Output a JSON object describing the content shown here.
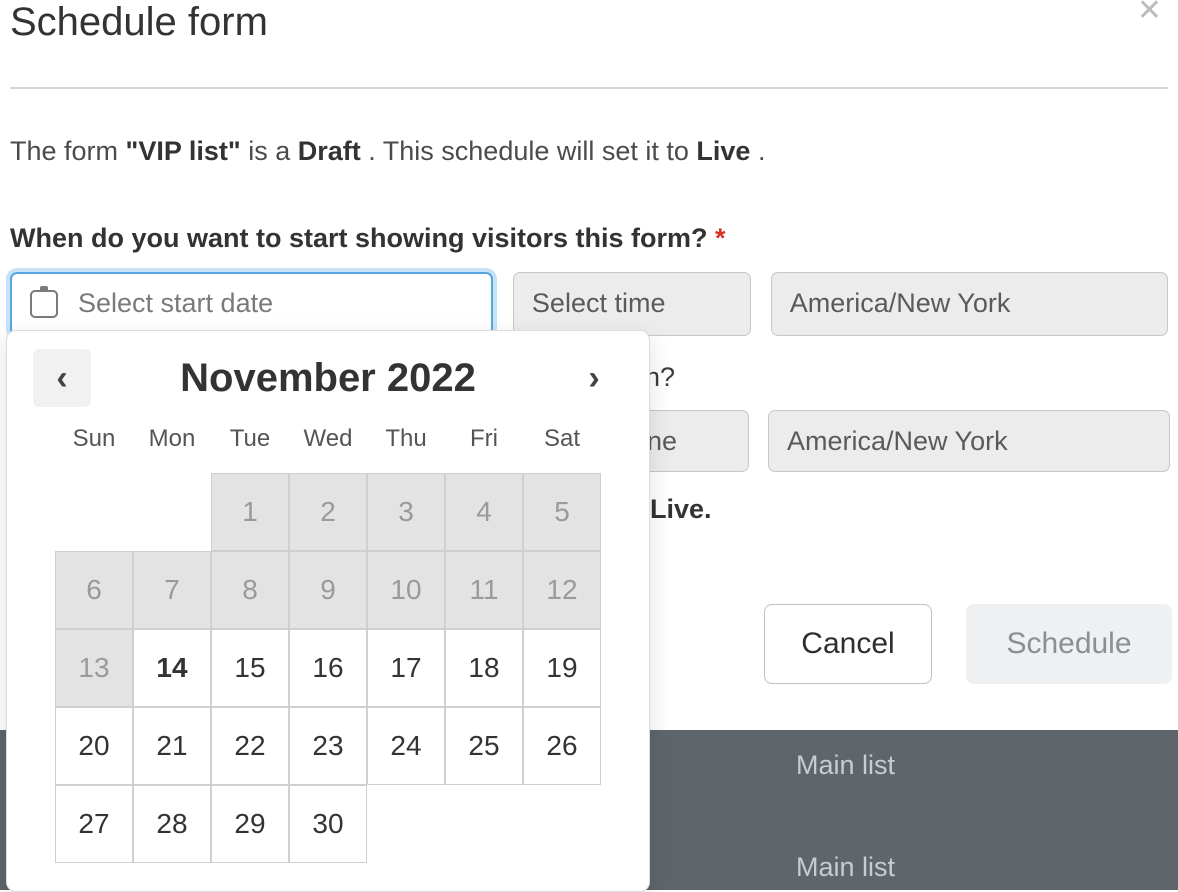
{
  "modal": {
    "title": "Schedule form",
    "description_prefix": "The form ",
    "form_name": "\"VIP list\"",
    "description_mid": " is a ",
    "status": "Draft",
    "description_suffix": ". This schedule will set it to ",
    "target_status": "Live",
    "description_end": "."
  },
  "start": {
    "question": "When do you want to start showing visitors this form?",
    "date_placeholder": "Select start date",
    "time_placeholder": "Select time",
    "timezone": "America/New York"
  },
  "end": {
    "question_tail": "n?",
    "time_fragment": "ne",
    "timezone": "America/New York"
  },
  "footer_note": {
    "prefix": "",
    "tail": "Live."
  },
  "actions": {
    "cancel": "Cancel",
    "schedule": "Schedule"
  },
  "background_rows": {
    "row1": "Main list",
    "row2": "Main list"
  },
  "datepicker": {
    "month_label": "November 2022",
    "dow": [
      "Sun",
      "Mon",
      "Tue",
      "Wed",
      "Thu",
      "Fri",
      "Sat"
    ],
    "days": [
      {
        "n": "",
        "cls": "blank"
      },
      {
        "n": "",
        "cls": "blank"
      },
      {
        "n": "1",
        "cls": "past"
      },
      {
        "n": "2",
        "cls": "past"
      },
      {
        "n": "3",
        "cls": "past"
      },
      {
        "n": "4",
        "cls": "past"
      },
      {
        "n": "5",
        "cls": "past"
      },
      {
        "n": "6",
        "cls": "past"
      },
      {
        "n": "7",
        "cls": "past"
      },
      {
        "n": "8",
        "cls": "past"
      },
      {
        "n": "9",
        "cls": "past"
      },
      {
        "n": "10",
        "cls": "past"
      },
      {
        "n": "11",
        "cls": "past"
      },
      {
        "n": "12",
        "cls": "past"
      },
      {
        "n": "13",
        "cls": "past"
      },
      {
        "n": "14",
        "cls": "today"
      },
      {
        "n": "15",
        "cls": ""
      },
      {
        "n": "16",
        "cls": ""
      },
      {
        "n": "17",
        "cls": ""
      },
      {
        "n": "18",
        "cls": ""
      },
      {
        "n": "19",
        "cls": ""
      },
      {
        "n": "20",
        "cls": ""
      },
      {
        "n": "21",
        "cls": ""
      },
      {
        "n": "22",
        "cls": ""
      },
      {
        "n": "23",
        "cls": ""
      },
      {
        "n": "24",
        "cls": ""
      },
      {
        "n": "25",
        "cls": ""
      },
      {
        "n": "26",
        "cls": ""
      },
      {
        "n": "27",
        "cls": ""
      },
      {
        "n": "28",
        "cls": ""
      },
      {
        "n": "29",
        "cls": ""
      },
      {
        "n": "30",
        "cls": ""
      }
    ]
  }
}
